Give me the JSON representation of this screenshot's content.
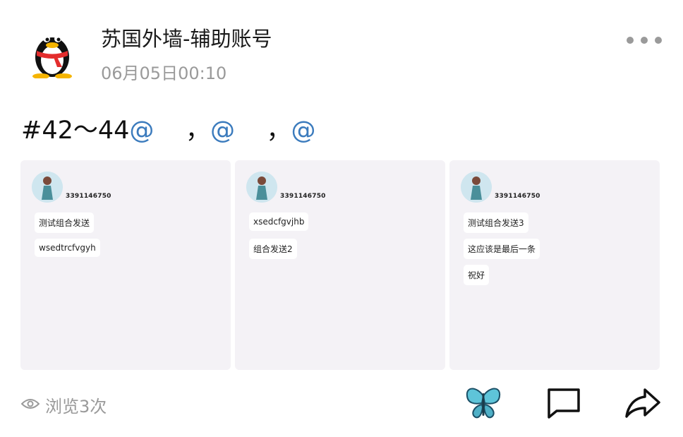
{
  "post": {
    "author": "苏国外墙-辅助账号",
    "time": "06月05日00:10",
    "text_tag": "#42～44",
    "mention_symbol": "@",
    "separator": "，"
  },
  "images": [
    {
      "id_label": "3391146750",
      "messages": [
        "测试组合发送",
        "wsedtrcfvgyh"
      ]
    },
    {
      "id_label": "3391146750",
      "messages": [
        "xsedcfgvjhb",
        "组合发送2"
      ]
    },
    {
      "id_label": "3391146750",
      "messages": [
        "测试组合发送3",
        "这应该是最后一条",
        "祝好"
      ]
    }
  ],
  "footer": {
    "views_label": "浏览3次",
    "icons": [
      "eye-icon",
      "butterfly-like-icon",
      "comment-icon",
      "share-icon"
    ]
  },
  "colors": {
    "mention": "#3b7bbd",
    "secondary_text": "#9a9a9a",
    "thumb_bg": "#f4f2f6"
  }
}
